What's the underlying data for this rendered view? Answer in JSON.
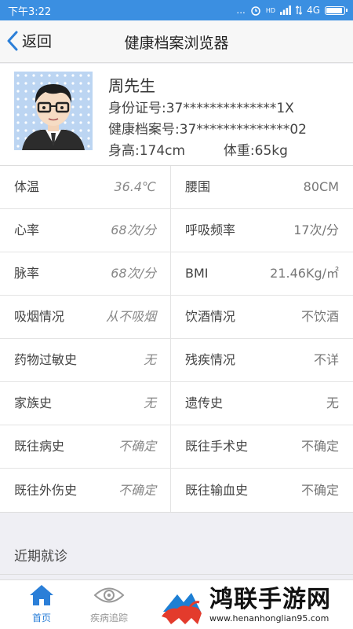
{
  "status_bar": {
    "time": "下午3:22",
    "dots": "...",
    "alarm_icon": "alarm-icon",
    "signal": "HD",
    "network": "4G"
  },
  "nav": {
    "back_label": "返回",
    "title": "健康档案浏览器"
  },
  "profile": {
    "name": "周先生",
    "id_label": "身份证号:",
    "id_value": "37**************1X",
    "record_label": "健康档案号:",
    "record_value": "37**************02",
    "height_label": "身高:",
    "height_value": "174cm",
    "weight_label": "体重:",
    "weight_value": "65kg"
  },
  "rows": [
    {
      "l1": "体温",
      "v1": "36.4℃",
      "l2": "腰围",
      "v2": "80CM"
    },
    {
      "l1": "心率",
      "v1": "68次/分",
      "l2": "呼吸频率",
      "v2": "17次/分"
    },
    {
      "l1": "脉率",
      "v1": "68次/分",
      "l2": "BMI",
      "v2": "21.46Kg/㎡"
    },
    {
      "l1": "吸烟情况",
      "v1": "从不吸烟",
      "l2": "饮酒情况",
      "v2": "不饮酒"
    },
    {
      "l1": "药物过敏史",
      "v1": "无",
      "l2": "残疾情况",
      "v2": "不详"
    },
    {
      "l1": "家族史",
      "v1": "无",
      "l2": "遗传史",
      "v2": "无"
    },
    {
      "l1": "既往病史",
      "v1": "不确定",
      "l2": "既往手术史",
      "v2": "不确定"
    },
    {
      "l1": "既往外伤史",
      "v1": "不确定",
      "l2": "既往输血史",
      "v2": "不确定"
    }
  ],
  "recent": {
    "title": "近期就诊"
  },
  "tabs": [
    {
      "label": "首页",
      "icon": "home-icon",
      "active": true
    },
    {
      "label": "疾病追踪",
      "icon": "eye-icon",
      "active": false
    }
  ],
  "watermark": {
    "title": "鸿联手游网",
    "url": "www.henanhonglian95.com"
  },
  "colors": {
    "accent": "#3b8fe1",
    "tab_active": "#2b7fd8"
  }
}
